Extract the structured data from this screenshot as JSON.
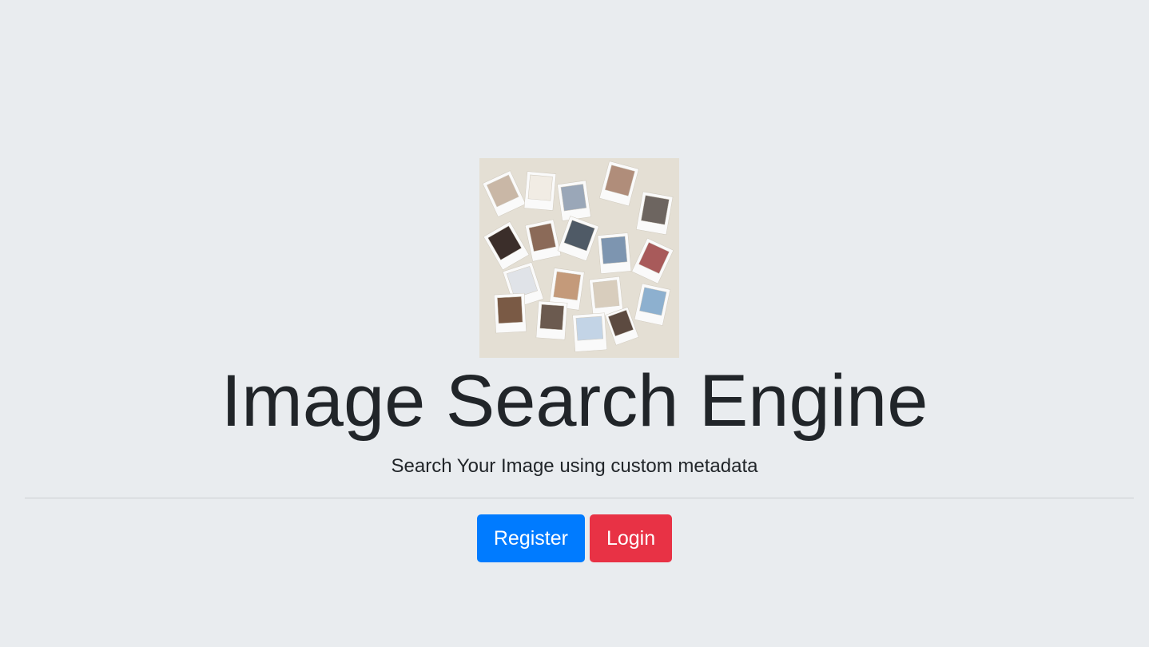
{
  "hero": {
    "title": "Image Search Engine",
    "subtitle": "Search Your Image using custom metadata",
    "image_alt": "collage-of-polaroid-photos"
  },
  "actions": {
    "register_label": "Register",
    "login_label": "Login"
  },
  "colors": {
    "background": "#e9ecef",
    "primary": "#007bff",
    "danger": "#e83245",
    "text": "#212529"
  }
}
